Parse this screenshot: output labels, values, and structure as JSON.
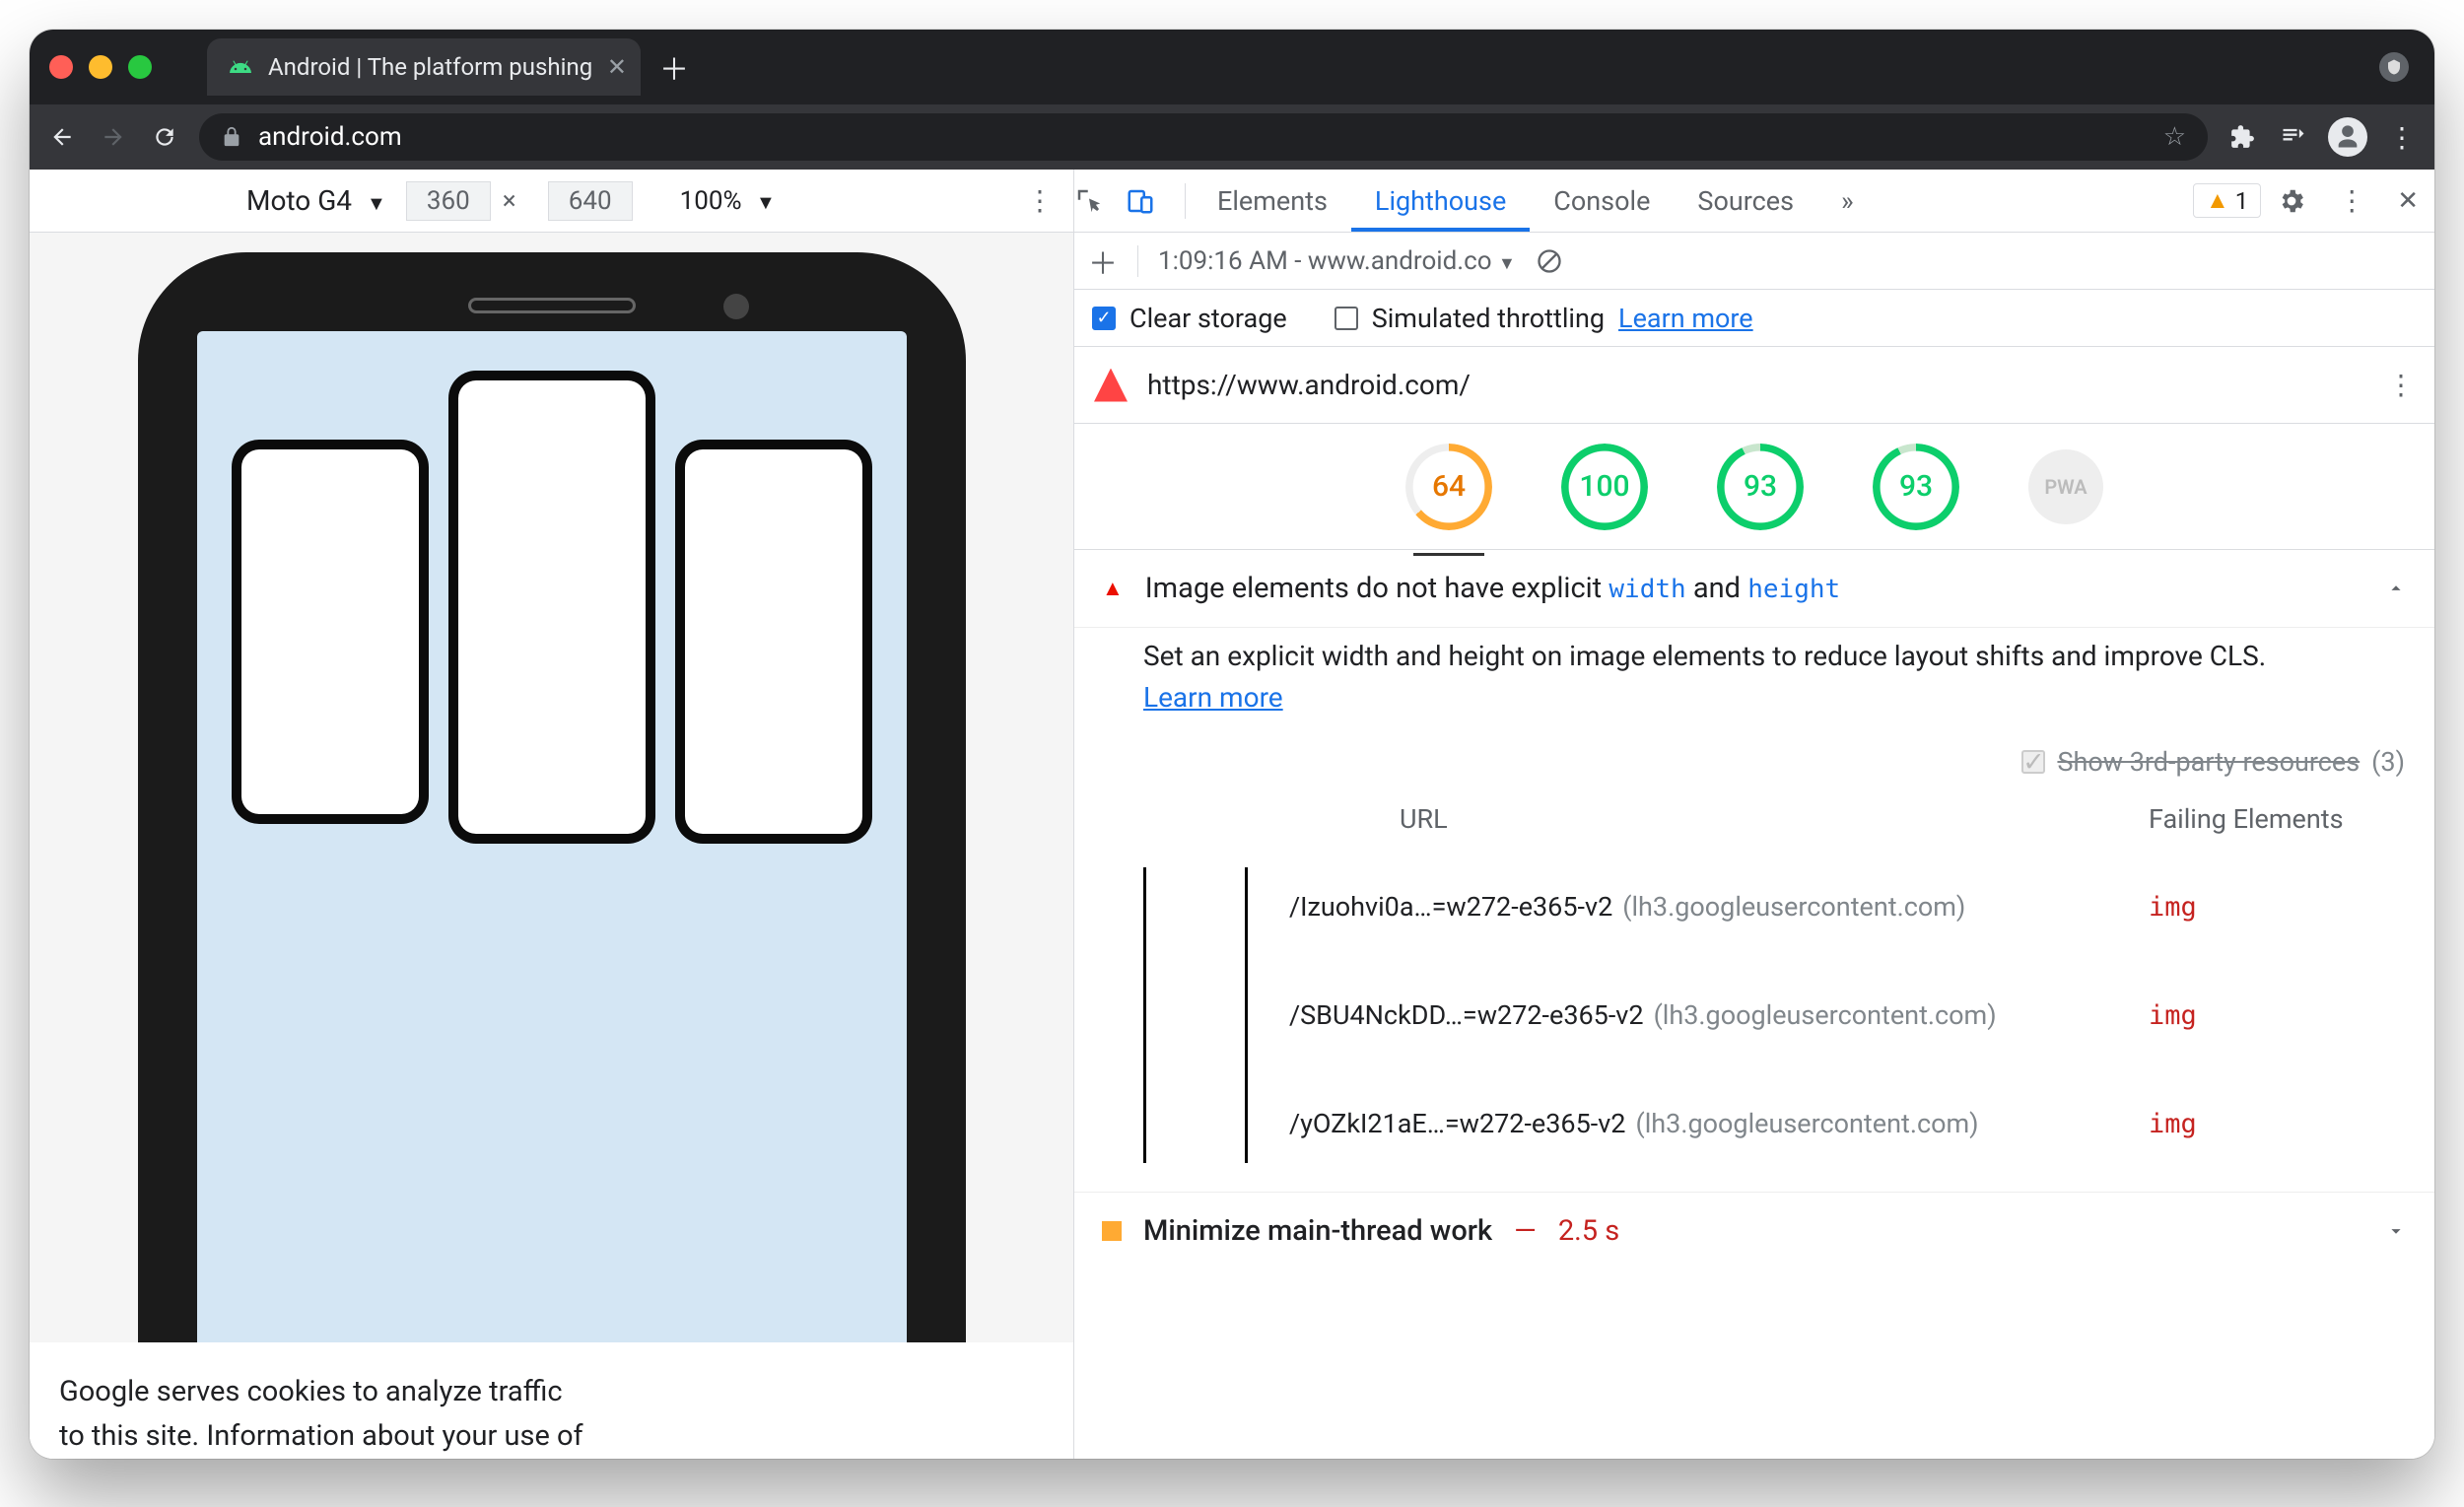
{
  "browser": {
    "tab_title": "Android | The platform pushing",
    "url_display": "android.com"
  },
  "device_toolbar": {
    "device": "Moto G4",
    "width": "360",
    "height": "640",
    "zoom": "100%"
  },
  "page": {
    "cookie_line1": "Google serves cookies to analyze traffic",
    "cookie_line2": "to this site. Information about your use of"
  },
  "devtools": {
    "tabs": {
      "elements": "Elements",
      "lighthouse": "Lighthouse",
      "console": "Console",
      "sources": "Sources"
    },
    "warning_count": "1",
    "subbar": {
      "timestamp": "1:09:16 AM - www.android.co"
    },
    "options": {
      "clear": "Clear storage",
      "throttle": "Simulated throttling",
      "learn": "Learn more"
    },
    "test_url": "https://www.android.com/",
    "scores": {
      "s1": "64",
      "s2": "100",
      "s3": "93",
      "s4": "93",
      "pwa": "PWA"
    },
    "audit1": {
      "pre": "Image elements do not have explicit",
      "code1": "width",
      "mid": "and",
      "code2": "height",
      "desc": "Set an explicit width and height on image elements to reduce layout shifts and improve CLS.",
      "learn": "Learn more",
      "third_label": "Show 3rd-party resources",
      "third_count": "(3)",
      "col_url": "URL",
      "col_fail": "Failing Elements",
      "rows": [
        {
          "path": "/Izuohvi0a…=w272-e365-v2",
          "host": "(lh3.googleusercontent.com)",
          "el": "img"
        },
        {
          "path": "/SBU4NckDD…=w272-e365-v2",
          "host": "(lh3.googleusercontent.com)",
          "el": "img"
        },
        {
          "path": "/yOZkI21aE…=w272-e365-v2",
          "host": "(lh3.googleusercontent.com)",
          "el": "img"
        }
      ]
    },
    "audit2": {
      "title": "Minimize main-thread work",
      "sep": "—",
      "time": "2.5 s"
    }
  }
}
